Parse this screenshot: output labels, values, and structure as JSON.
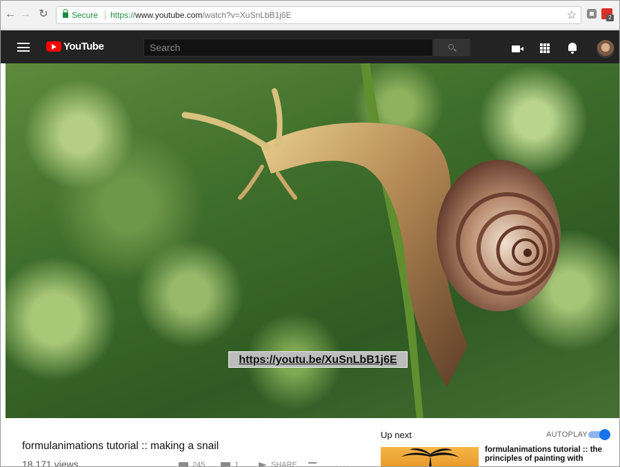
{
  "browser": {
    "secure_label": "Secure",
    "url_scheme": "https://",
    "url_host": "www.youtube.com",
    "url_path": "/watch?v=XuSnLbB1j6E",
    "extension_badge": "2",
    "accent_secure": "#1e8e3e"
  },
  "youtube": {
    "logo_text": "YouTube",
    "search_placeholder": "Search",
    "brand_color": "#ff0000"
  },
  "video": {
    "overlay_url": "https://youtu.be/XuSnLbB1j6E",
    "title": "formulanimations tutorial :: making a snail",
    "views": "18.171 views",
    "likes": "245",
    "dislikes": "1",
    "share_label": "SHARE",
    "more_label": "..."
  },
  "sidebar": {
    "up_next_label": "Up next",
    "autoplay_label": "AUTOPLAY",
    "autoplay_on": true,
    "next_video_title": "formulanimations tutorial :: the principles of painting with"
  }
}
